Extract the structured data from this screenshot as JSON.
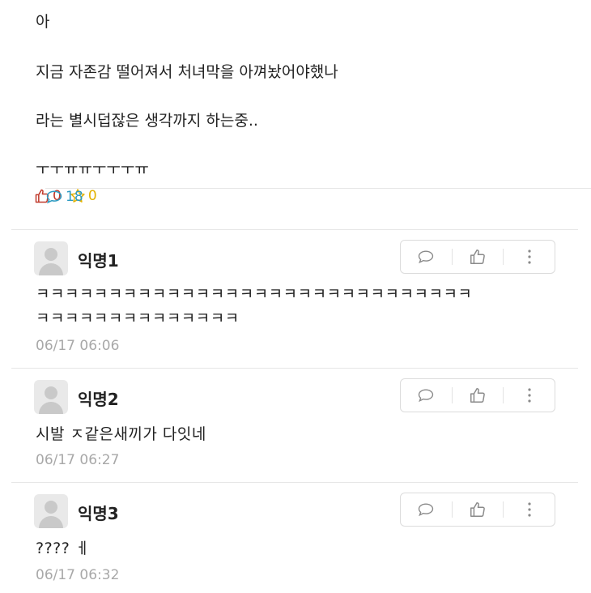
{
  "post": {
    "lines": [
      "아",
      "지금 자존감 떨어져서 처녀막을 아껴놨어야했나",
      "라는 별시덥잖은 생각까지 하는중..",
      "ㅜㅜㅠㅠㅜㅜㅜㅠ"
    ],
    "stats": {
      "likes": "0",
      "comments": "18",
      "scraps": "0"
    }
  },
  "colors": {
    "like": "#c0392b",
    "comment": "#2e9bc2",
    "scrap": "#e3b200",
    "timestamp": "#a8a8a8"
  },
  "comments": [
    {
      "nickname": "익명1",
      "text_lines": [
        "ㅋㅋㅋㅋㅋㅋㅋㅋㅋㅋㅋㅋㅋㅋㅋㅋㅋㅋㅋㅋㅋㅋㅋㅋㅋㅋㅋㅋㅋㅋ",
        "ㅋㅋㅋㅋㅋㅋㅋㅋㅋㅋㅋㅋㅋㅋ"
      ],
      "time": "06/17 06:06"
    },
    {
      "nickname": "익명2",
      "text_lines": [
        "시발 ㅈ같은새끼가 다잇네"
      ],
      "time": "06/17 06:27"
    },
    {
      "nickname": "익명3",
      "text_lines": [
        "???? ㅔ"
      ],
      "time": "06/17 06:32"
    }
  ],
  "icons": [
    "thumbs-up-icon",
    "speech-bubble-icon",
    "star-icon",
    "more-vertical-icon",
    "avatar-placeholder-icon"
  ]
}
